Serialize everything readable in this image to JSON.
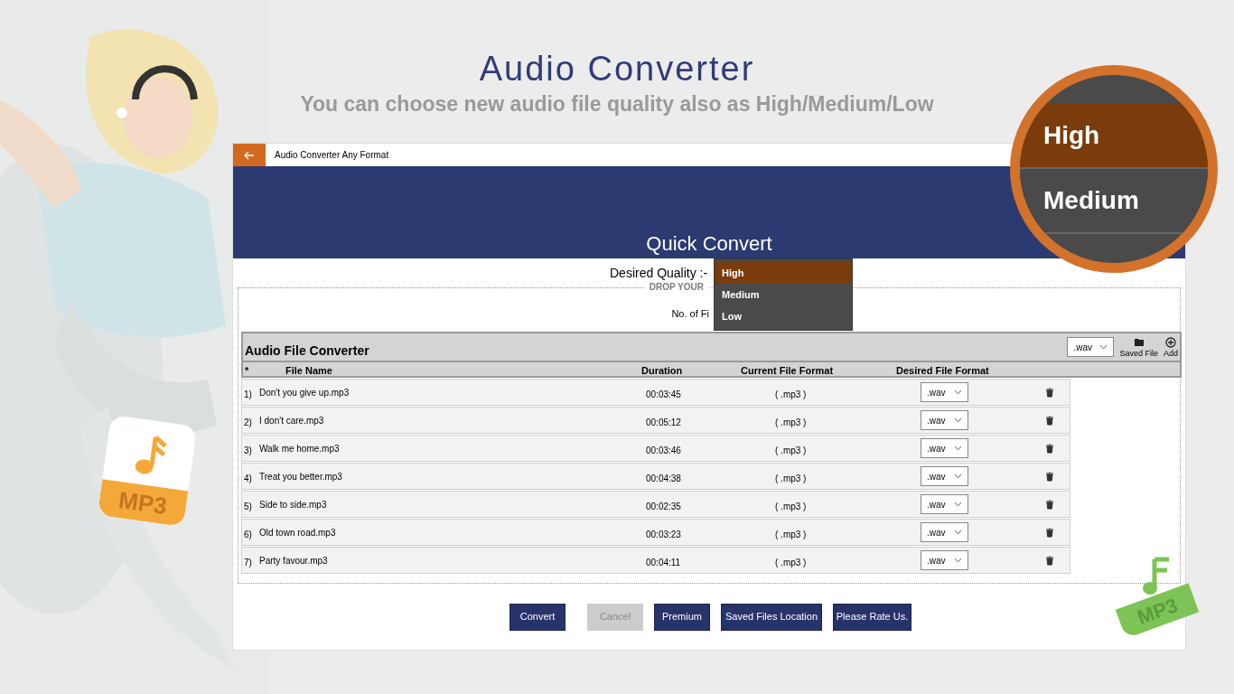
{
  "promo": {
    "title": "Audio Converter",
    "subtitle": "You can choose new audio file quality also as High/Medium/Low"
  },
  "badges": [
    {
      "kind": "orange",
      "label": "MP3"
    },
    {
      "kind": "green",
      "label": "MP3"
    }
  ],
  "magnifier": {
    "options": [
      {
        "label": "High",
        "selected": true
      },
      {
        "label": "Medium",
        "selected": false
      }
    ]
  },
  "window": {
    "title": "Audio Converter Any Format"
  },
  "header": {
    "title": "Quick Convert"
  },
  "quality": {
    "label": "Desired Quality :-",
    "options": [
      {
        "label": "High",
        "selected": true
      },
      {
        "label": "Medium",
        "selected": false
      },
      {
        "label": "Low",
        "selected": false
      }
    ]
  },
  "drop_zone": {
    "legend": "DROP YOUR",
    "count_label": "No. of Fi"
  },
  "converter": {
    "title": "Audio File Converter",
    "format": ".wav",
    "saved_file": "Saved File",
    "add": "Add",
    "columns": [
      "*",
      "File Name",
      "Duration",
      "Current File Format",
      "Desired File Format"
    ],
    "rows": [
      {
        "index": "1)",
        "name": "Don't you give up.mp3",
        "duration": "00:03:45",
        "current": "( .mp3 )",
        "desired": ".wav"
      },
      {
        "index": "2)",
        "name": "I don't care.mp3",
        "duration": "00:05:12",
        "current": "( .mp3 )",
        "desired": ".wav"
      },
      {
        "index": "3)",
        "name": "Walk me home.mp3",
        "duration": "00:03:46",
        "current": "( .mp3 )",
        "desired": ".wav"
      },
      {
        "index": "4)",
        "name": "Treat you better.mp3",
        "duration": "00:04:38",
        "current": "( .mp3 )",
        "desired": ".wav"
      },
      {
        "index": "5)",
        "name": "Side to side.mp3",
        "duration": "00:02:35",
        "current": "( .mp3 )",
        "desired": ".wav"
      },
      {
        "index": "6)",
        "name": "Old town road.mp3",
        "duration": "00:03:23",
        "current": "( .mp3 )",
        "desired": ".wav"
      },
      {
        "index": "7)",
        "name": "Party favour.mp3",
        "duration": "00:04:11",
        "current": "( .mp3 )",
        "desired": ".wav"
      }
    ]
  },
  "buttons": [
    {
      "label": "Convert",
      "disabled": false
    },
    {
      "label": "Cancel",
      "disabled": true
    },
    {
      "label": "Premium",
      "disabled": false
    },
    {
      "label": "Saved Files Location",
      "disabled": false
    },
    {
      "label": "Please Rate Us.",
      "disabled": false
    }
  ]
}
